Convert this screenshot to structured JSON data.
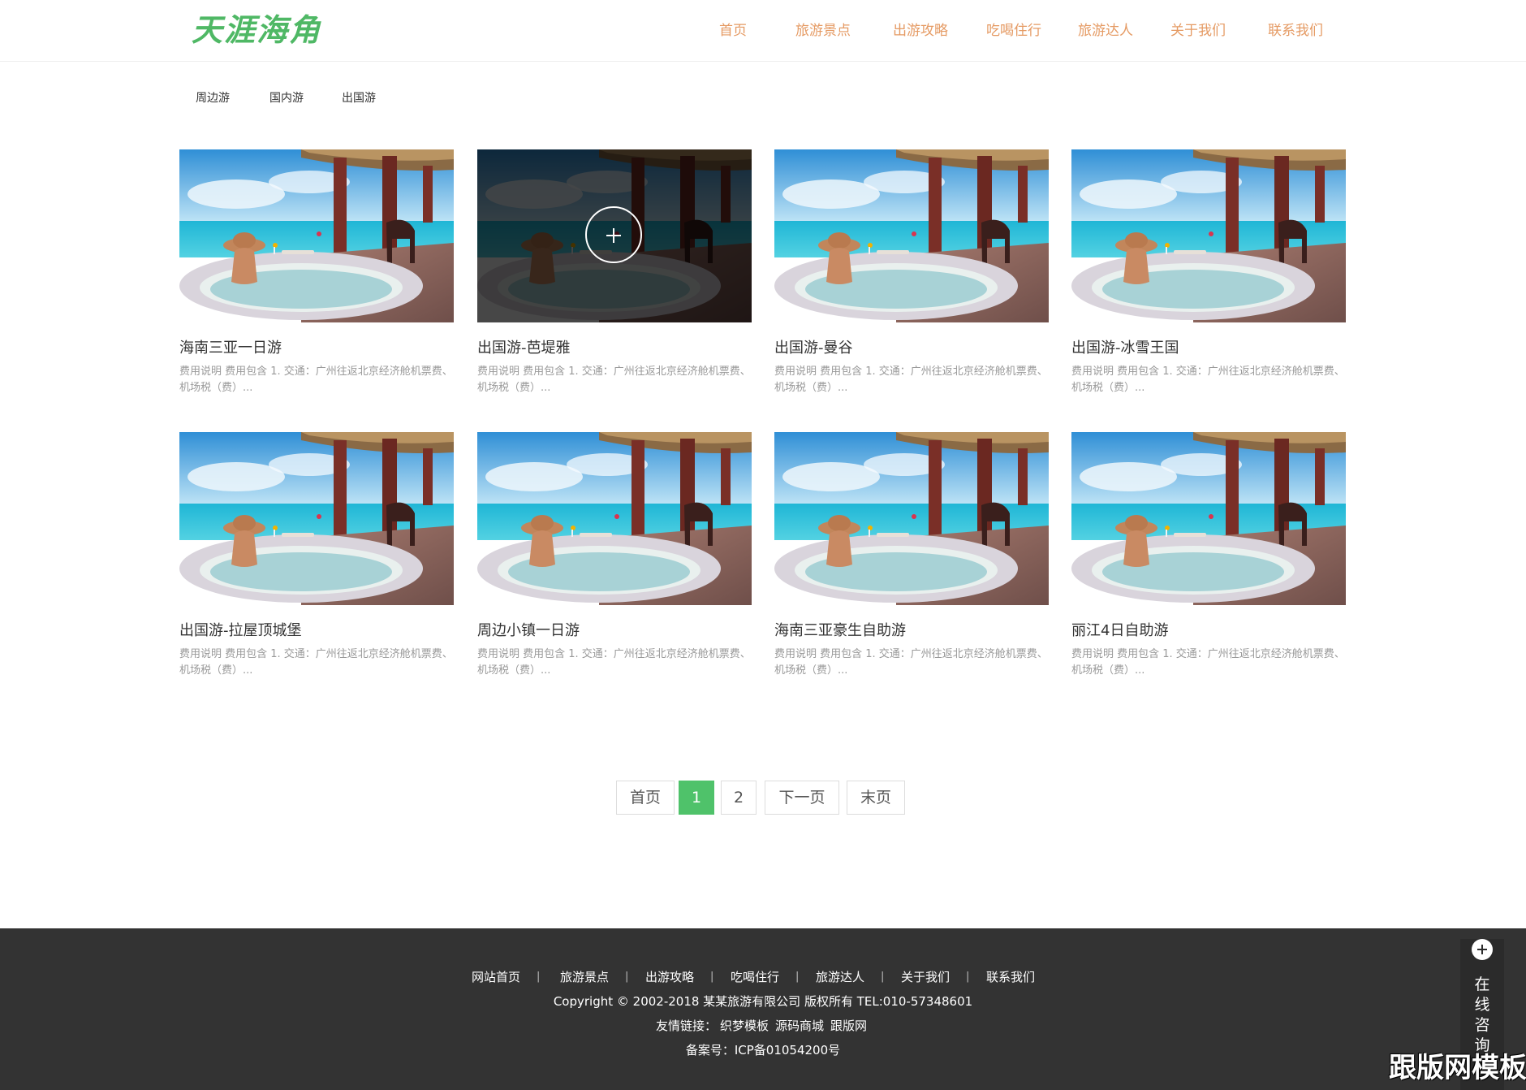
{
  "header": {
    "logo": "天涯海角",
    "nav": [
      "首页",
      "旅游景点",
      "出游攻略",
      "吃喝住行",
      "旅游达人",
      "关于我们",
      "联系我们"
    ]
  },
  "categories": [
    "周边游",
    "国内游",
    "出国游"
  ],
  "cards": [
    {
      "title": "海南三亚一日游",
      "desc": "费用说明 费用包含 1. 交通：广州往返北京经济舱机票费、机场税（费）..."
    },
    {
      "title": "出国游-芭堤雅",
      "desc": "费用说明 费用包含 1. 交通：广州往返北京经济舱机票费、机场税（费）...",
      "hovered": true
    },
    {
      "title": "出国游-曼谷",
      "desc": "费用说明 费用包含 1. 交通：广州往返北京经济舱机票费、机场税（费）..."
    },
    {
      "title": "出国游-冰雪王国",
      "desc": "费用说明 费用包含 1. 交通：广州往返北京经济舱机票费、机场税（费）..."
    },
    {
      "title": "出国游-拉屋顶城堡",
      "desc": "费用说明 费用包含 1. 交通：广州往返北京经济舱机票费、机场税（费）..."
    },
    {
      "title": "周边小镇一日游",
      "desc": "费用说明 费用包含 1. 交通：广州往返北京经济舱机票费、机场税（费）..."
    },
    {
      "title": "海南三亚豪生自助游",
      "desc": "费用说明 费用包含 1. 交通：广州往返北京经济舱机票费、机场税（费）..."
    },
    {
      "title": "丽江4日自助游",
      "desc": "费用说明 费用包含 1. 交通：广州往返北京经济舱机票费、机场税（费）..."
    }
  ],
  "pagination": {
    "first": "首页",
    "pages": [
      "1",
      "2"
    ],
    "current": "1",
    "next": "下一页",
    "last": "末页"
  },
  "footer": {
    "links": [
      "网站首页",
      "旅游景点",
      "出游攻略",
      "吃喝住行",
      "旅游达人",
      "关于我们",
      "联系我们"
    ],
    "copyright": "Copyright © 2002-2018 某某旅游有限公司 版权所有 TEL:010-57348601",
    "friend_label": "友情链接：",
    "friend_links": [
      "织梦模板",
      "源码商城",
      "跟版网"
    ],
    "icp": "备案号：ICP备01054200号"
  },
  "consult": {
    "label": "在线咨询"
  },
  "watermark": "跟版网模板",
  "colors": {
    "accent_green": "#4fc26a",
    "logo_green": "#4fb865",
    "nav_orange": "#e59a63",
    "footer_bg": "#333333"
  },
  "icons": {
    "overlay": "plus-circle-icon",
    "consult": "plus-circle-icon"
  }
}
